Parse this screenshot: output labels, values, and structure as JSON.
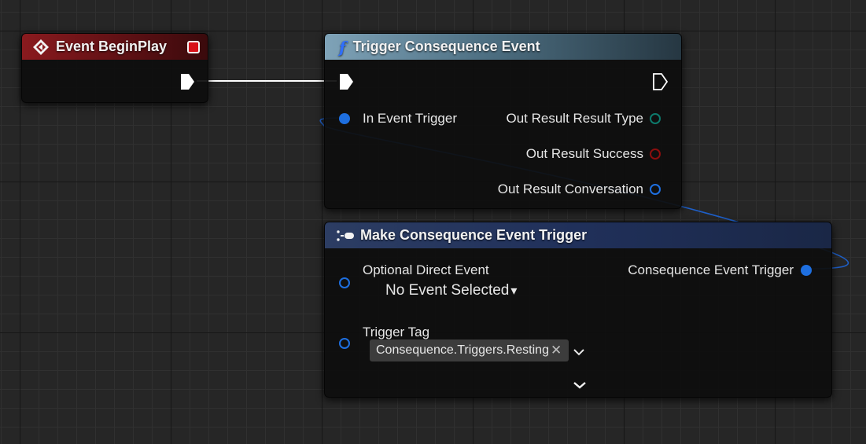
{
  "event_node": {
    "title": "Event BeginPlay",
    "header_color": "#8a1a1e"
  },
  "trigger_node": {
    "title": "Trigger Consequence Event",
    "function_glyph": "f",
    "header_color": "#7fa3b8",
    "in_event_trigger": "In Event Trigger",
    "out_result_type": "Out Result Result Type",
    "out_result_success": "Out Result Success",
    "out_result_conversation": "Out Result Conversation"
  },
  "make_node": {
    "title": "Make Consequence Event Trigger",
    "header_color": "#2c3d63",
    "optional_direct_event": "Optional Direct Event",
    "no_event_selected": "No Event Selected",
    "dropdown_arrow": "▾",
    "consequence_event_trigger": "Consequence Event Trigger",
    "trigger_tag": "Trigger Tag",
    "tag_value": "Consequence.Triggers.Resting",
    "tag_clear": "✕",
    "tag_chevron": "⌵",
    "expand_chevron": "⌵"
  },
  "pin_colors": {
    "struct_blue": "#1e6fe0",
    "byte_teal": "#0d7a6c",
    "bool_red": "#8c0e0e",
    "exec_white": "#ffffff"
  },
  "icons": {
    "event_icon": "diamond-arrow-icon",
    "stop_icon": "red-square-icon",
    "function_icon": "function-f-icon",
    "make_icon": "make-struct-icon"
  }
}
